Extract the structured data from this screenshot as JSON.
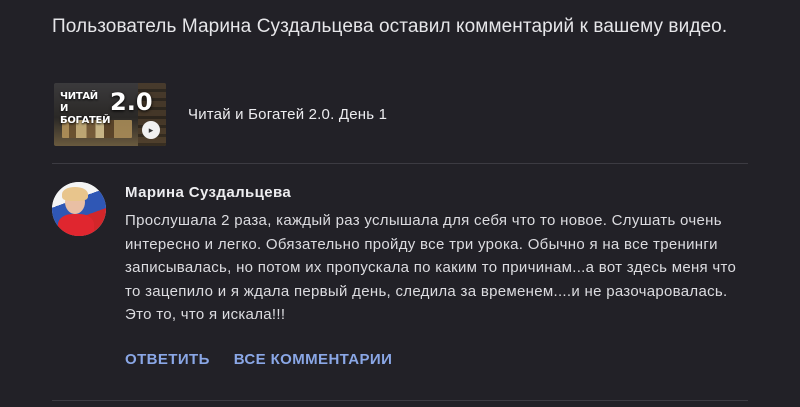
{
  "notification": {
    "headline": "Пользователь Марина Суздальцева оставил комментарий к вашему видео."
  },
  "video": {
    "title": "Читай и Богатей 2.0. День 1",
    "thumbnail": {
      "text": "ЧИТАЙ И БОГАТЕЙ",
      "version": "2.0"
    }
  },
  "comment": {
    "author": "Марина Суздальцева",
    "text": "Прослушала 2 раза, каждый раз услышала для себя что то новое. Слушать очень интересно и легко. Обязательно пройду все три урока. Обычно я на все тренинги записывалась, но потом их пропускала по каким то причинам...а вот здесь меня что то зацепило и я ждала первый день, следила за временем....и не разочаровалась. Это то, что я искала!!!"
  },
  "actions": {
    "reply_label": "ОТВЕТИТЬ",
    "all_comments_label": "ВСЕ КОММЕНТАРИИ"
  },
  "colors": {
    "background": "#222127",
    "accent_link": "#8aa7e6",
    "divider": "#3c3b42"
  }
}
